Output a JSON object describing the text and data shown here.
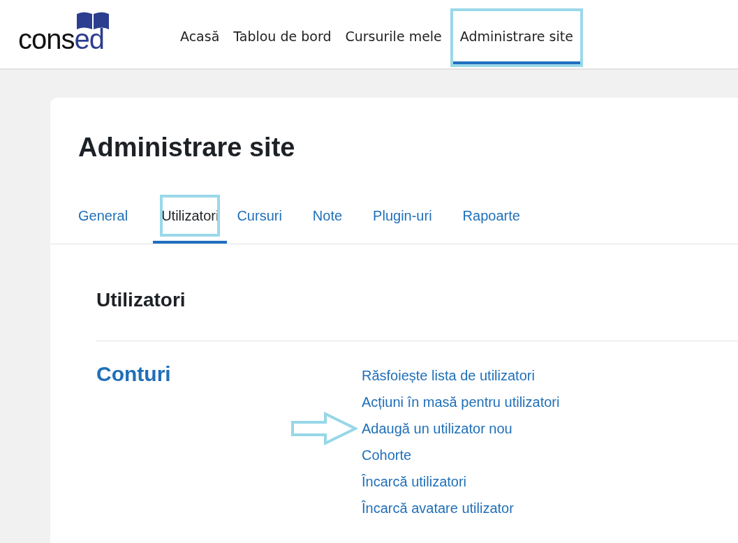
{
  "logo": {
    "text_dark": "cons",
    "text_accent": "ed"
  },
  "nav": [
    {
      "label": "Acasă",
      "selected": false,
      "highlighted": false
    },
    {
      "label": "Tablou de bord",
      "selected": false,
      "highlighted": false
    },
    {
      "label": "Cursurile mele",
      "selected": false,
      "highlighted": false
    },
    {
      "label": "Administrare site",
      "selected": true,
      "highlighted": true
    }
  ],
  "page_title": "Administrare site",
  "tabs": [
    {
      "label": "General",
      "selected": false,
      "highlighted": false
    },
    {
      "label": "Utilizatori",
      "selected": true,
      "highlighted": true
    },
    {
      "label": "Cursuri",
      "selected": false,
      "highlighted": false
    },
    {
      "label": "Note",
      "selected": false,
      "highlighted": false
    },
    {
      "label": "Plugin-uri",
      "selected": false,
      "highlighted": false
    },
    {
      "label": "Rapoarte",
      "selected": false,
      "highlighted": false
    }
  ],
  "section_title": "Utilizatori",
  "category": {
    "title": "Conturi",
    "links": [
      {
        "label": "Răsfoiește lista de utilizatori",
        "pointed": false
      },
      {
        "label": "Acțiuni în masă pentru utilizatori",
        "pointed": false
      },
      {
        "label": "Adaugă un utilizator nou",
        "pointed": true
      },
      {
        "label": "Cohorte",
        "pointed": false
      },
      {
        "label": "Încarcă utilizatori",
        "pointed": false
      },
      {
        "label": "Încarcă avatare utilizator",
        "pointed": false
      }
    ]
  }
}
